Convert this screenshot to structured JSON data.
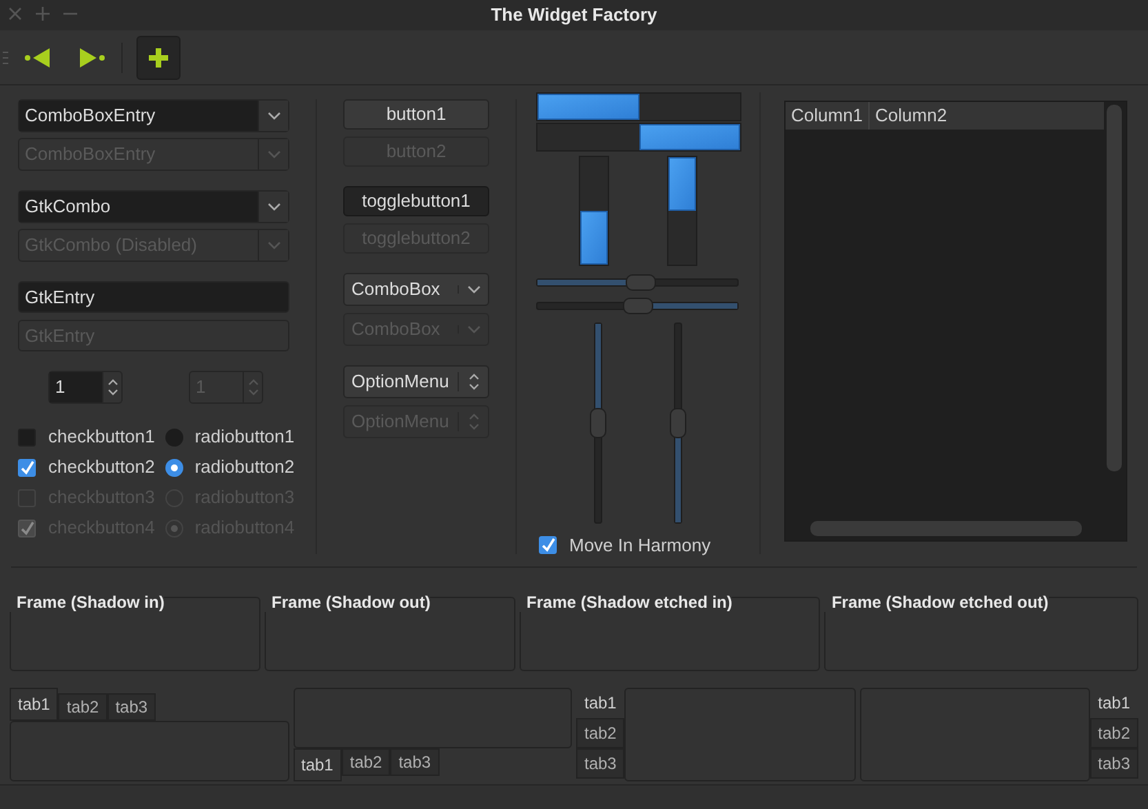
{
  "window": {
    "title": "The Widget Factory"
  },
  "toolbar": [
    {
      "kind": "back",
      "selected": false
    },
    {
      "kind": "forward",
      "selected": false
    },
    {
      "kind": "add",
      "selected": true
    }
  ],
  "combos": [
    {
      "value": "ComboBoxEntry",
      "disabled": false
    },
    {
      "value": "ComboBoxEntry",
      "disabled": true
    },
    {
      "value": "GtkCombo",
      "disabled": false
    },
    {
      "value": "GtkCombo (Disabled)",
      "disabled": true
    }
  ],
  "entries": [
    {
      "value": "GtkEntry",
      "disabled": false
    },
    {
      "value": "GtkEntry",
      "disabled": true
    }
  ],
  "spin_buttons": [
    {
      "value": "1",
      "disabled": false
    },
    {
      "value": "1",
      "disabled": true
    }
  ],
  "check_buttons": [
    {
      "label": "checkbutton1",
      "checked": false,
      "disabled": false
    },
    {
      "label": "checkbutton2",
      "checked": true,
      "disabled": false
    },
    {
      "label": "checkbutton3",
      "checked": false,
      "disabled": true
    },
    {
      "label": "checkbutton4",
      "checked": true,
      "disabled": true
    }
  ],
  "radio_buttons": [
    {
      "label": "radiobutton1",
      "selected": false,
      "disabled": false
    },
    {
      "label": "radiobutton2",
      "selected": true,
      "disabled": false
    },
    {
      "label": "radiobutton3",
      "selected": false,
      "disabled": true
    },
    {
      "label": "radiobutton4",
      "selected": true,
      "disabled": true
    }
  ],
  "buttons": [
    {
      "label": "button1",
      "pressed": false,
      "disabled": false
    },
    {
      "label": "button2",
      "pressed": false,
      "disabled": true
    },
    {
      "label": "togglebutton1",
      "pressed": true,
      "disabled": false
    },
    {
      "label": "togglebutton2",
      "pressed": false,
      "disabled": true
    }
  ],
  "combo_boxes": [
    {
      "kind": "combo",
      "label": "ComboBox",
      "disabled": false
    },
    {
      "kind": "combo",
      "label": "ComboBox",
      "disabled": true
    },
    {
      "kind": "option",
      "label": "OptionMenu",
      "disabled": false
    },
    {
      "kind": "option",
      "label": "OptionMenu",
      "disabled": true
    }
  ],
  "progress_bars": [
    {
      "kind": "ltr",
      "level": 0.5
    },
    {
      "kind": "rtl",
      "level": 0.5
    },
    {
      "kind": "btt",
      "level": 0.5
    },
    {
      "kind": "ttb",
      "level": 0.5
    }
  ],
  "scales": [
    {
      "kind": "ltr",
      "level": 0.52
    },
    {
      "kind": "rtl",
      "level": 0.5
    },
    {
      "kind": "ttb",
      "level": 0.5
    },
    {
      "kind": "btt",
      "level": 0.5
    }
  ],
  "harmony": {
    "label": "Move In Harmony",
    "checked": true
  },
  "tree": {
    "columns": [
      "Column1",
      "Column2"
    ]
  },
  "frames": [
    {
      "label": "Frame (Shadow in)"
    },
    {
      "label": "Frame (Shadow out)"
    },
    {
      "label": "Frame (Shadow etched in)"
    },
    {
      "label": "Frame (Shadow etched out)"
    }
  ],
  "notebooks": [
    {
      "kind": "top",
      "tabs": [
        {
          "label": "tab1",
          "selected": true
        },
        {
          "label": "tab2",
          "selected": false
        },
        {
          "label": "tab3",
          "selected": false
        }
      ]
    },
    {
      "kind": "bottom",
      "tabs": [
        {
          "label": "tab1",
          "selected": true
        },
        {
          "label": "tab2",
          "selected": false
        },
        {
          "label": "tab3",
          "selected": false
        }
      ]
    },
    {
      "kind": "left",
      "tabs": [
        {
          "label": "tab1",
          "selected": true
        },
        {
          "label": "tab2",
          "selected": false
        },
        {
          "label": "tab3",
          "selected": false
        }
      ]
    },
    {
      "kind": "right",
      "tabs": [
        {
          "label": "tab1",
          "selected": true
        },
        {
          "label": "tab2",
          "selected": false
        },
        {
          "label": "tab3",
          "selected": false
        }
      ]
    }
  ]
}
